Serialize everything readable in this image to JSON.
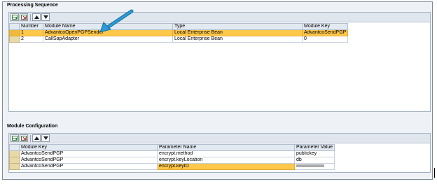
{
  "processing_sequence": {
    "title": "Processing Sequence",
    "columns": [
      "Number",
      "Module Name",
      "Type",
      "Module Key"
    ],
    "rows": [
      {
        "number": "1",
        "module_name": "AdvantcoOpenPGPSender",
        "type": "Local Enterprise Bean",
        "module_key": "AdvantcoSendPGP"
      },
      {
        "number": "2",
        "module_name": "CallSapAdapter",
        "type": "Local Enterprise Bean",
        "module_key": "0"
      }
    ]
  },
  "module_configuration": {
    "title": "Module Configuration",
    "columns": [
      "Module Key",
      "Parameter Name",
      "Parameter Value"
    ],
    "rows": [
      {
        "module_key": "AdvantcoSendPGP",
        "parameter_name": "encrypt.method",
        "parameter_value": "publickey"
      },
      {
        "module_key": "AdvantcoSendPGP",
        "parameter_name": "encrypt.keyLocation",
        "parameter_value": "db"
      },
      {
        "module_key": "AdvantcoSendPGP",
        "parameter_name": "encrypt.keyID",
        "parameter_value": ""
      }
    ]
  },
  "colors": {
    "highlight": "#ffc84a",
    "arrow": "#2a9bd5",
    "header": "#e2e9f0"
  },
  "icons": [
    "insert-row-icon",
    "delete-row-icon",
    "move-up-icon",
    "move-down-icon",
    "callout-arrow-icon"
  ]
}
